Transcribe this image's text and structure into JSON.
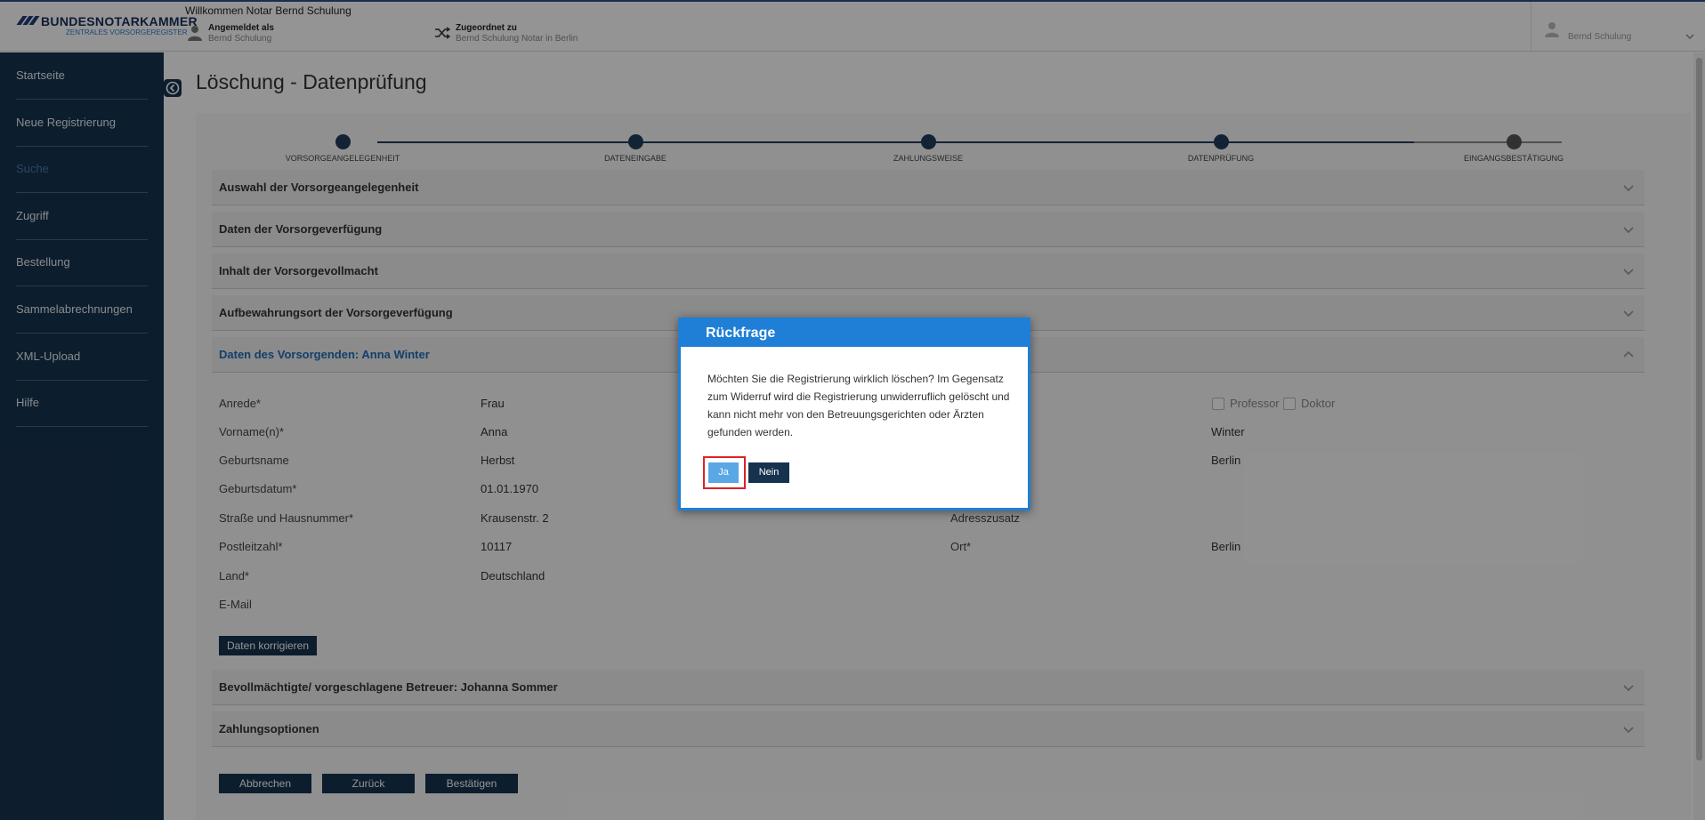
{
  "header": {
    "logo_title": "BUNDESNOTARKAMMER",
    "logo_subtitle": "ZENTRALES VORSORGEREGISTER",
    "welcome": "Willkommen Notar Bernd Schulung",
    "logged_in_label": "Angemeldet als",
    "logged_in_value": "Bernd Schulung",
    "assigned_label": "Zugeordnet zu",
    "assigned_value": "Bernd Schulung Notar in Berlin",
    "user_name": "Bernd Schulung"
  },
  "sidebar": {
    "items": [
      {
        "label": "Startseite",
        "active": false
      },
      {
        "label": "Neue Registrierung",
        "active": false
      },
      {
        "label": "Suche",
        "active": true
      },
      {
        "label": "Zugriff",
        "active": false
      },
      {
        "label": "Bestellung",
        "active": false
      },
      {
        "label": "Sammelabrechnungen",
        "active": false
      },
      {
        "label": "XML-Upload",
        "active": false
      },
      {
        "label": "Hilfe",
        "active": false
      }
    ]
  },
  "page": {
    "title": "Löschung - Datenprüfung"
  },
  "stepper": {
    "steps": [
      {
        "label": "VORSORGEANGELEGENHEIT",
        "done": true
      },
      {
        "label": "DATENEINGABE",
        "done": true
      },
      {
        "label": "ZAHLUNGSWEISE",
        "done": true
      },
      {
        "label": "DATENPRÜFUNG",
        "done": true
      },
      {
        "label": "EINGANGSBESTÄTIGUNG",
        "done": false
      }
    ]
  },
  "sections": [
    {
      "title": "Auswahl der Vorsorgeangelegenheit",
      "open": false
    },
    {
      "title": "Daten der Vorsorgeverfügung",
      "open": false
    },
    {
      "title": "Inhalt der Vorsorgevollmacht",
      "open": false
    },
    {
      "title": "Aufbewahrungsort der Vorsorgeverfügung",
      "open": false
    },
    {
      "title": "Daten des Vorsorgenden: Anna Winter",
      "open": true
    },
    {
      "title": "Bevollmächtigte/ vorgeschlagene Betreuer: Johanna Sommer",
      "open": false
    },
    {
      "title": "Zahlungsoptionen",
      "open": false
    }
  ],
  "person": {
    "left": [
      {
        "label": "Anrede*",
        "value": "Frau"
      },
      {
        "label": "Vorname(n)*",
        "value": "Anna"
      },
      {
        "label": "Geburtsname",
        "value": "Herbst"
      },
      {
        "label": "Geburtsdatum*",
        "value": "01.01.1970"
      },
      {
        "label": "Straße und Hausnummer*",
        "value": "Krausenstr. 2"
      },
      {
        "label": "Postleitzahl*",
        "value": "10117"
      },
      {
        "label": "Land*",
        "value": "Deutschland"
      },
      {
        "label": "E-Mail",
        "value": ""
      }
    ],
    "right": [
      {
        "label": "",
        "value": "Winter"
      },
      {
        "label": "",
        "value": "Berlin"
      },
      {
        "label": "Adresszusatz",
        "value": ""
      },
      {
        "label": "Ort*",
        "value": "Berlin"
      }
    ],
    "titles": [
      {
        "label": "Professor",
        "checked": false
      },
      {
        "label": "Doktor",
        "checked": false
      }
    ],
    "correct_button": "Daten korrigieren"
  },
  "footer_buttons": {
    "cancel": "Abbrechen",
    "back": "Zurück",
    "confirm": "Bestätigen"
  },
  "modal": {
    "title": "Rückfrage",
    "message": "Möchten Sie die Registrierung wirklich löschen? Im Gegensatz zum Widerruf wird die Registrierung unwiderruflich gelöscht und kann nicht mehr von den Betreuungsgerichten oder Ärzten gefunden werden.",
    "yes_label": "Ja",
    "no_label": "Nein"
  },
  "colors": {
    "sidebar_bg": "#16324e",
    "accent_blue": "#1f7fd6",
    "highlight_red": "#dd2222"
  }
}
